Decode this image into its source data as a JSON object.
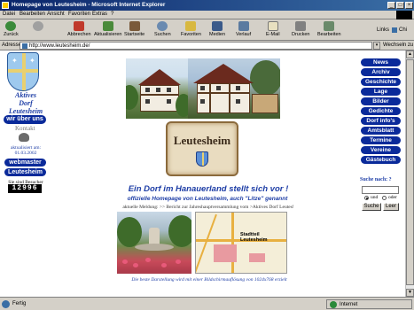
{
  "window": {
    "title": "Homepage von Leutesheim - Microsoft Internet Explorer",
    "controls": [
      "_",
      "□",
      "×"
    ]
  },
  "menu": [
    "Datei",
    "Bearbeiten",
    "Ansicht",
    "Favoriten",
    "Extras",
    "?"
  ],
  "toolbar": {
    "buttons": [
      {
        "label": "Zurück",
        "icon": "back-arrow-icon"
      },
      {
        "label": "",
        "icon": "forward-arrow-icon"
      },
      {
        "label": "Abbrechen",
        "icon": "stop-icon"
      },
      {
        "label": "Aktualisieren",
        "icon": "refresh-icon"
      },
      {
        "label": "Startseite",
        "icon": "home-icon"
      },
      {
        "label": "Suchen",
        "icon": "search-icon"
      },
      {
        "label": "Favoriten",
        "icon": "favorites-icon"
      },
      {
        "label": "Medien",
        "icon": "media-icon"
      },
      {
        "label": "Verlauf",
        "icon": "history-icon"
      },
      {
        "label": "E-Mail",
        "icon": "mail-icon"
      },
      {
        "label": "Drucken",
        "icon": "print-icon"
      },
      {
        "label": "Bearbeiten",
        "icon": "edit-icon"
      }
    ],
    "links_label": "Links",
    "links_extra": "Chi"
  },
  "address": {
    "label": "Adresse",
    "url": "http://www.leutesheim.de/",
    "go_label": "Wechseln zu"
  },
  "left": {
    "title_line1": "Aktives",
    "title_line2": "Dorf",
    "title_line3": "Leutesheim",
    "about_button": "wir über uns",
    "contact": "Kontakt",
    "updated_label": "aktualisiert am:",
    "updated_date": "01.03.2002",
    "webmaster_button": "webmaster",
    "leutesheim_button": "Leutesheim",
    "visitors_label": "Sie sind Besucher",
    "counter": "12996"
  },
  "main": {
    "sign_text": "Leutesheim",
    "headline": "Ein Dorf im Hanauerland stellt sich vor !",
    "subheadline": "offizielle Homepage von Leutesheim, auch \"Litze\" genannt",
    "news": "aktuelle Meldung: >> Bericht zur Jahreshauptversammlung vom >Aktives Dorf Leutes!",
    "map_label_1": "Stadtteil",
    "map_label_2": "Leutesheim",
    "footer": "Die beste Darstellung wird mit einer Bildschirmauflösung von 1024x768 erzielt"
  },
  "right_nav": [
    "News",
    "Archiv",
    "Geschichte",
    "Lage",
    "Bilder",
    "Gedichte",
    "Dorf info's",
    "Amtsblatt",
    "Termine",
    "Vereine",
    "Gästebuch"
  ],
  "search": {
    "title": "Suche nach: ?",
    "value": "",
    "radio_and": "und",
    "radio_or": "oder",
    "search_button": "Suche",
    "clear_button": "Leer"
  },
  "status": {
    "text": "Fertig",
    "zone": "Internet"
  },
  "colors": {
    "nav_button": "#0a2a9a",
    "headline": "#1e3ea6",
    "titlebar": "#0a246a"
  }
}
